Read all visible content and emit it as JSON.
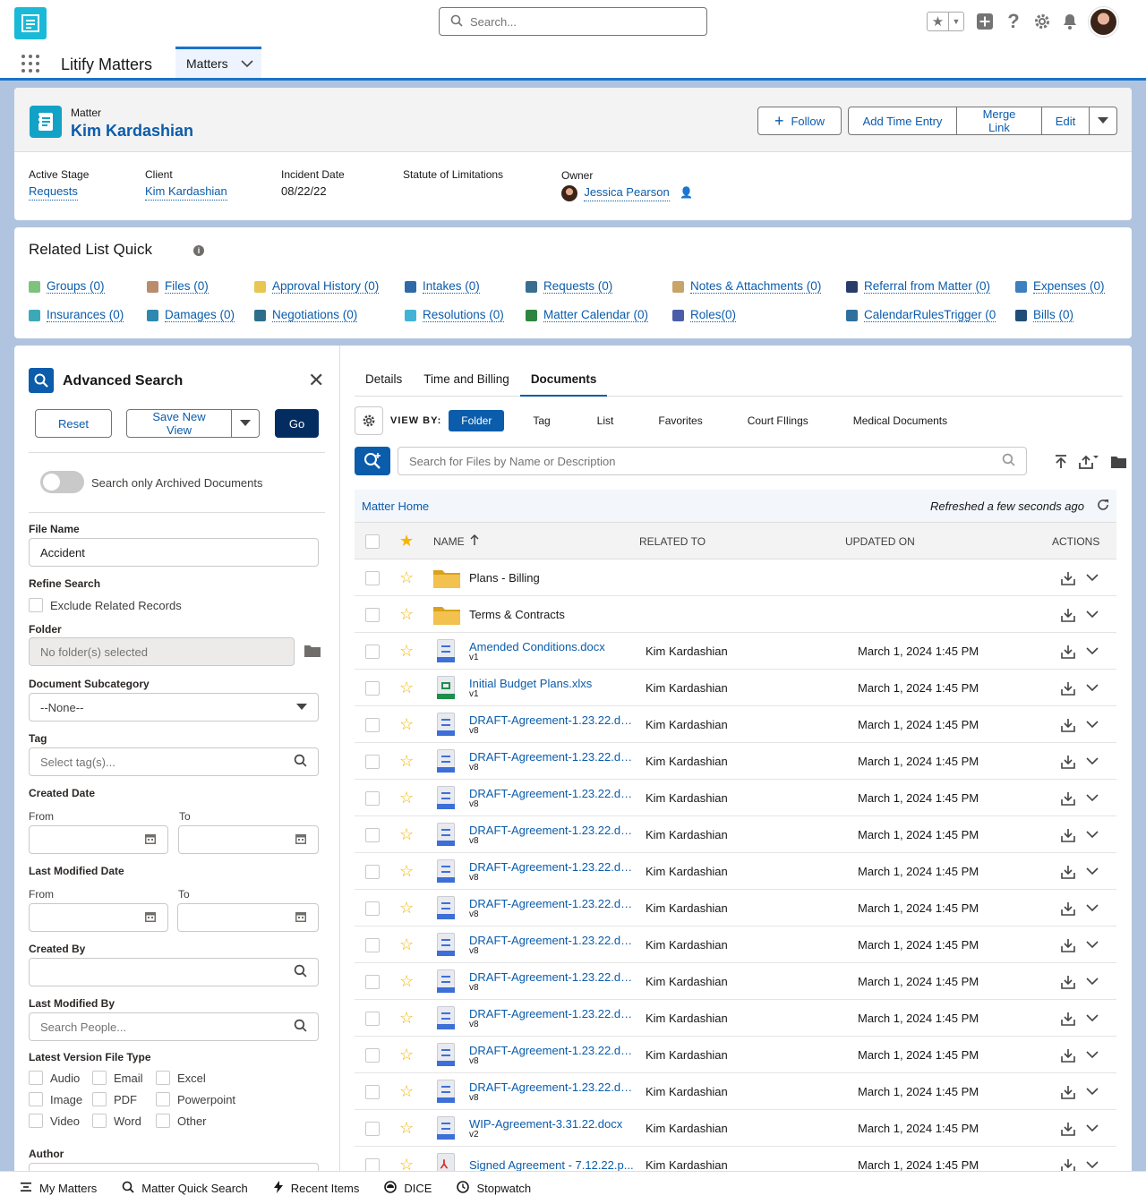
{
  "header": {
    "search_placeholder": "Search...",
    "icons": [
      "favorites-star-icon",
      "add-icon",
      "help-icon",
      "setup-gear-icon",
      "notifications-bell-icon"
    ]
  },
  "nav": {
    "app_name": "Litify Matters",
    "active_tab": "Matters"
  },
  "record": {
    "type_label": "Matter",
    "name": "Kim Kardashian",
    "buttons": {
      "follow": "Follow",
      "add_time": "Add Time Entry",
      "merge_link": "Merge Link",
      "edit": "Edit"
    },
    "fields": {
      "active_stage_label": "Active Stage",
      "active_stage": "Requests",
      "client_label": "Client",
      "client": "Kim Kardashian",
      "incident_date_label": "Incident Date",
      "incident_date": "08/22/22",
      "sol_label": "Statute of Limitations",
      "owner_label": "Owner",
      "owner": "Jessica Pearson"
    }
  },
  "related_list": {
    "title": "Related List Quick",
    "items": [
      {
        "label": "Groups (0)",
        "color": "#7ec27e"
      },
      {
        "label": "Files (0)",
        "color": "#b98c6e"
      },
      {
        "label": "Approval History (0)",
        "color": "#e8c651"
      },
      {
        "label": "Intakes (0)",
        "color": "#2f6aa6"
      },
      {
        "label": "Requests (0)",
        "color": "#3a6e8f"
      },
      {
        "label": "Notes & Attachments (0)",
        "color": "#c8a36a"
      },
      {
        "label": "Referral from Matter (0)",
        "color": "#283b6a"
      },
      {
        "label": "Expenses (0)",
        "color": "#3d7fbf"
      },
      {
        "label": "Insurances (0)",
        "color": "#3ca9b8"
      },
      {
        "label": "Damages (0)",
        "color": "#2e88b0"
      },
      {
        "label": "Negotiations (0)",
        "color": "#2d6f8b"
      },
      {
        "label": "Resolutions (0)",
        "color": "#42b3d6"
      },
      {
        "label": "Matter Calendar (0)",
        "color": "#2e8540"
      },
      {
        "label": "Roles(0)",
        "color": "#4a5ea8"
      },
      {
        "label": "CalendarRulesTrigger (0",
        "color": "#2f6f9e"
      },
      {
        "label": "Bills (0)",
        "color": "#1f4e79"
      }
    ]
  },
  "advanced_search": {
    "title": "Advanced Search",
    "reset": "Reset",
    "save_view": "Save New View",
    "go": "Go",
    "archived_toggle": "Search only Archived Documents",
    "file_name_label": "File Name",
    "file_name_value": "Accident",
    "refine_label": "Refine Search",
    "exclude_related": "Exclude Related Records",
    "folder_label": "Folder",
    "folder_placeholder": "No folder(s) selected",
    "subcategory_label": "Document Subcategory",
    "subcategory_value": "--None--",
    "tag_label": "Tag",
    "tag_placeholder": "Select tag(s)...",
    "created_date_label": "Created Date",
    "from_label": "From",
    "to_label": "To",
    "last_modified_date_label": "Last Modified Date",
    "created_by_label": "Created By",
    "last_modified_by_label": "Last Modified By",
    "people_placeholder": "Search People...",
    "file_type_label": "Latest Version File Type",
    "file_types": [
      "Audio",
      "Email",
      "Excel",
      "Image",
      "PDF",
      "Powerpoint",
      "Video",
      "Word",
      "Other"
    ],
    "author_label": "Author"
  },
  "documents": {
    "tabs": [
      "Details",
      "Time and Billing",
      "Documents"
    ],
    "view_by_label": "VIEW BY:",
    "view_options": [
      "Folder",
      "Tag",
      "List",
      "Favorites",
      "Court FIlings",
      "Medical Documents"
    ],
    "search_placeholder": "Search for Files by Name or Description",
    "breadcrumb": "Matter Home",
    "refreshed": "Refreshed a few seconds ago",
    "columns": {
      "name": "NAME",
      "related_to": "RELATED TO",
      "updated_on": "UPDATED ON",
      "actions": "ACTIONS"
    },
    "rows": [
      {
        "name": "Plans - Billing",
        "version": "",
        "kind": "folder",
        "related": "",
        "updated": ""
      },
      {
        "name": "Terms & Contracts",
        "version": "",
        "kind": "folder",
        "related": "",
        "updated": ""
      },
      {
        "name": "Amended Conditions.docx",
        "version": "v1",
        "kind": "word",
        "related": "Kim Kardashian",
        "updated": "March 1, 2024 1:45 PM"
      },
      {
        "name": "Initial Budget Plans.xlxs",
        "version": "v1",
        "kind": "excel",
        "related": "Kim Kardashian",
        "updated": "March 1, 2024 1:45 PM"
      },
      {
        "name": "DRAFT-Agreement-1.23.22.do...",
        "version": "v8",
        "kind": "word",
        "related": "Kim Kardashian",
        "updated": "March 1, 2024 1:45 PM"
      },
      {
        "name": "DRAFT-Agreement-1.23.22.do...",
        "version": "v8",
        "kind": "word",
        "related": "Kim Kardashian",
        "updated": "March 1, 2024 1:45 PM"
      },
      {
        "name": "DRAFT-Agreement-1.23.22.do...",
        "version": "v8",
        "kind": "word",
        "related": "Kim Kardashian",
        "updated": "March 1, 2024 1:45 PM"
      },
      {
        "name": "DRAFT-Agreement-1.23.22.do...",
        "version": "v8",
        "kind": "word",
        "related": "Kim Kardashian",
        "updated": "March 1, 2024 1:45 PM"
      },
      {
        "name": "DRAFT-Agreement-1.23.22.do...",
        "version": "v8",
        "kind": "word",
        "related": "Kim Kardashian",
        "updated": "March 1, 2024 1:45 PM"
      },
      {
        "name": "DRAFT-Agreement-1.23.22.do...",
        "version": "v8",
        "kind": "word",
        "related": "Kim Kardashian",
        "updated": "March 1, 2024 1:45 PM"
      },
      {
        "name": "DRAFT-Agreement-1.23.22.do...",
        "version": "v8",
        "kind": "word",
        "related": "Kim Kardashian",
        "updated": "March 1, 2024 1:45 PM"
      },
      {
        "name": "DRAFT-Agreement-1.23.22.do...",
        "version": "v8",
        "kind": "word",
        "related": "Kim Kardashian",
        "updated": "March 1, 2024 1:45 PM"
      },
      {
        "name": "DRAFT-Agreement-1.23.22.do...",
        "version": "v8",
        "kind": "word",
        "related": "Kim Kardashian",
        "updated": "March 1, 2024 1:45 PM"
      },
      {
        "name": "DRAFT-Agreement-1.23.22.do...",
        "version": "v8",
        "kind": "word",
        "related": "Kim Kardashian",
        "updated": "March 1, 2024 1:45 PM"
      },
      {
        "name": "DRAFT-Agreement-1.23.22.do...",
        "version": "v8",
        "kind": "word",
        "related": "Kim Kardashian",
        "updated": "March 1, 2024 1:45 PM"
      },
      {
        "name": "WIP-Agreement-3.31.22.docx",
        "version": "v2",
        "kind": "word",
        "related": "Kim Kardashian",
        "updated": "March 1, 2024 1:45 PM"
      },
      {
        "name": "Signed Agreement - 7.12.22.p...",
        "version": "",
        "kind": "pdf",
        "related": "Kim Kardashian",
        "updated": "March 1, 2024 1:45 PM"
      }
    ]
  },
  "utility_bar": [
    "My Matters",
    "Matter Quick Search",
    "Recent Items",
    "DICE",
    "Stopwatch"
  ],
  "colors": {
    "brand": "#0b5cab",
    "accent": "#1b73c9",
    "star": "#f4b400",
    "folder": "#e8b530"
  }
}
